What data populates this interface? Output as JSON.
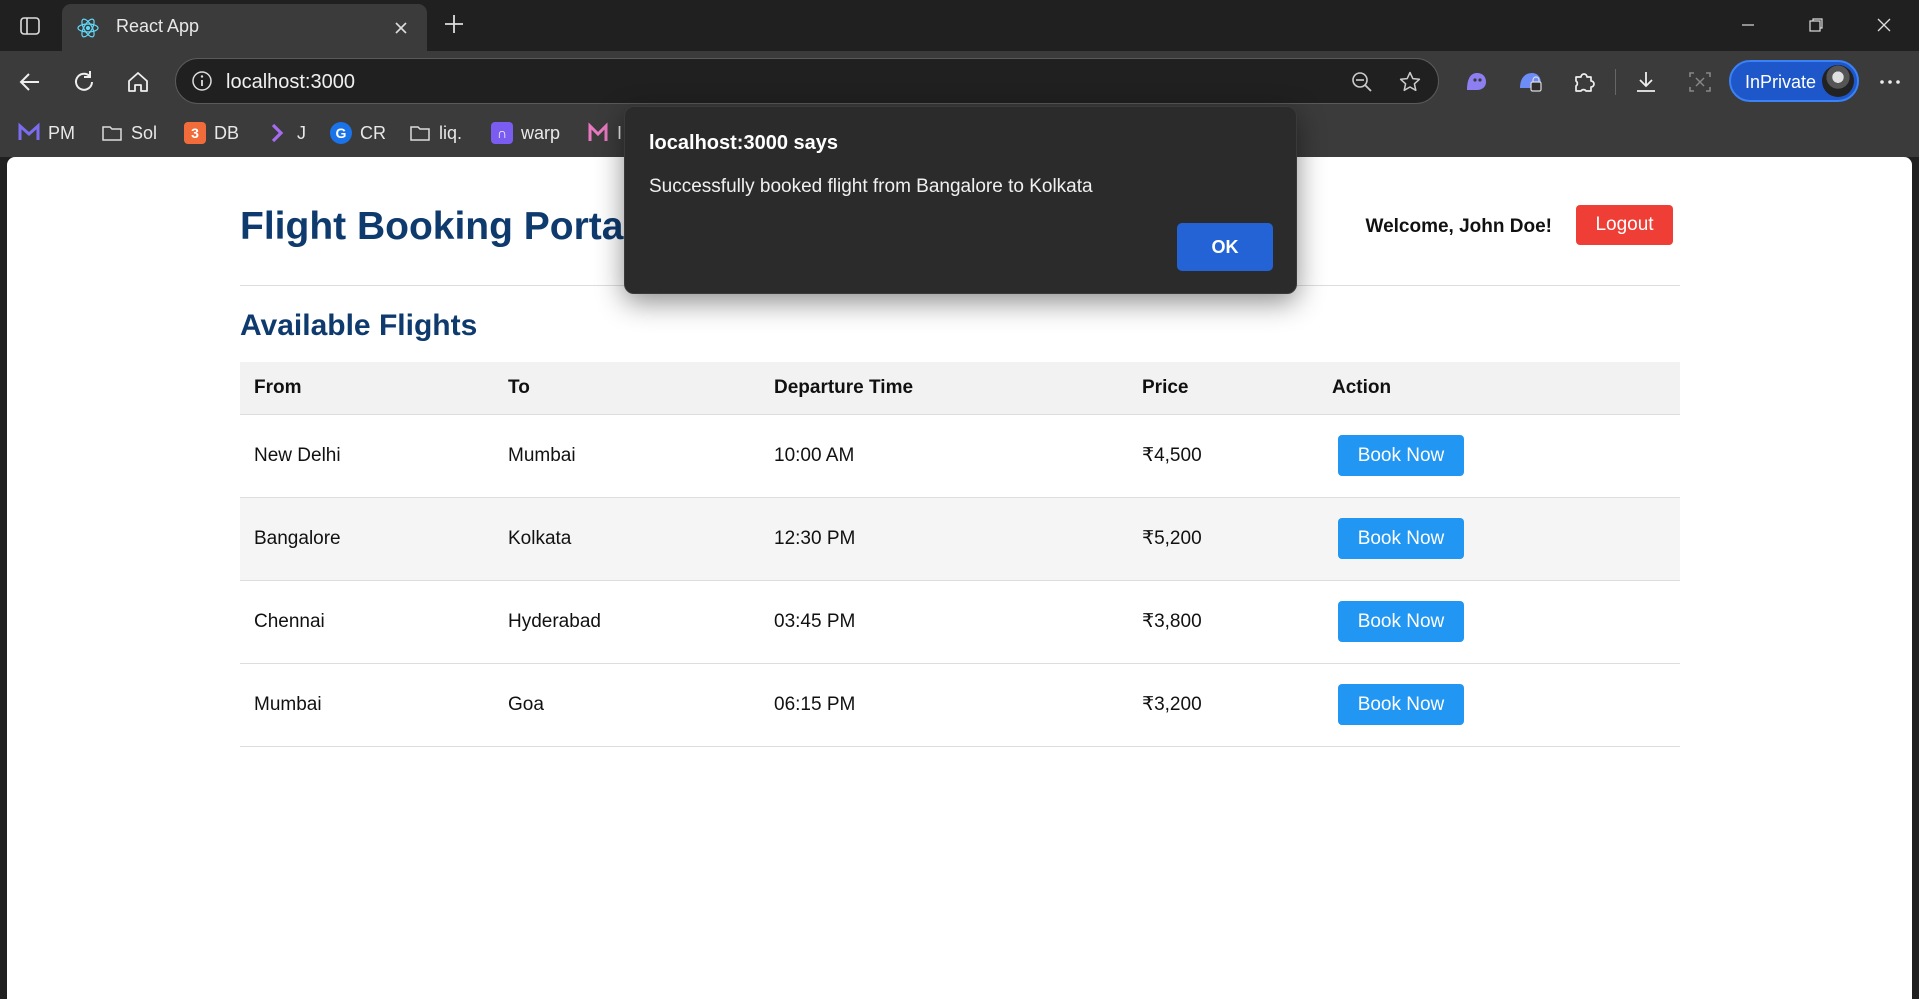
{
  "browser": {
    "tab_title": "React App",
    "url": "localhost:3000",
    "inprivate_label": "InPrivate",
    "favorites": [
      {
        "label": "PM",
        "icon": "mail-m-icon"
      },
      {
        "label": "Sol",
        "icon": "folder-icon"
      },
      {
        "label": "DB",
        "icon": "db-app-icon"
      },
      {
        "label": "J",
        "icon": "jira-icon"
      },
      {
        "label": "CR",
        "icon": "cr-app-icon"
      },
      {
        "label": "liq.",
        "icon": "folder-icon"
      },
      {
        "label": "warp",
        "icon": "warp-app-icon"
      },
      {
        "label": "I",
        "icon": "m-app-icon"
      }
    ]
  },
  "app": {
    "portal_title": "Flight Booking Portal",
    "welcome_text": "Welcome, John Doe!",
    "logout_label": "Logout",
    "section_title": "Available Flights",
    "table": {
      "headers": [
        "From",
        "To",
        "Departure Time",
        "Price",
        "Action"
      ],
      "rows": [
        {
          "from": "New Delhi",
          "to": "Mumbai",
          "departure": "10:00 AM",
          "price": "₹4,500",
          "action": "Book Now"
        },
        {
          "from": "Bangalore",
          "to": "Kolkata",
          "departure": "12:30 PM",
          "price": "₹5,200",
          "action": "Book Now"
        },
        {
          "from": "Chennai",
          "to": "Hyderabad",
          "departure": "03:45 PM",
          "price": "₹3,800",
          "action": "Book Now"
        },
        {
          "from": "Mumbai",
          "to": "Goa",
          "departure": "06:15 PM",
          "price": "₹3,200",
          "action": "Book Now"
        }
      ]
    }
  },
  "dialog": {
    "title": "localhost:3000 says",
    "message": "Successfully booked flight from Bangalore to Kolkata",
    "ok_label": "OK"
  },
  "colors": {
    "title_navy": "#0e3a6e",
    "logout_red": "#ef3e36",
    "book_blue": "#2196f3",
    "dialog_ok_blue": "#2463d6"
  }
}
